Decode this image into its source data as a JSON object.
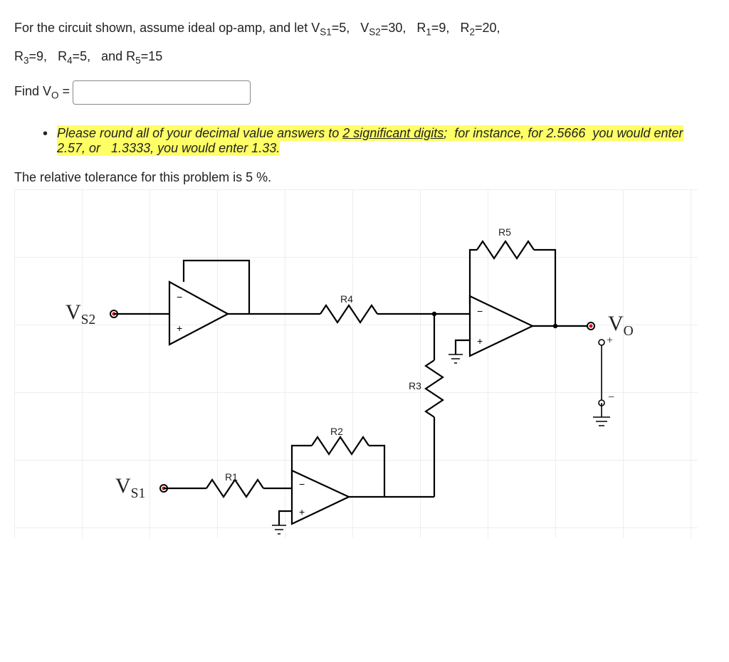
{
  "problem": {
    "line1_prefix": "For the circuit shown, assume ideal op-amp, and let V",
    "vs1_sub": "S1",
    "vs1_val": "=5,",
    "gap1": "   V",
    "vs2_sub": "S2",
    "vs2_val": "=30,",
    "r1": "   R",
    "r1_sub": "1",
    "r1_val": "=9,",
    "r2": "   R",
    "r2_sub": "2",
    "r2_val": "=20,",
    "line2_r3": "R",
    "r3_sub": "3",
    "r3_val": "=9,",
    "r4": "   R",
    "r4_sub": "4",
    "r4_val": "=5,",
    "and": "   and R",
    "r5_sub": "5",
    "r5_val": "=15"
  },
  "find": {
    "prefix": "Find V",
    "sub": "O",
    "eq": " = "
  },
  "note": {
    "t1": "Please round all of your decimal value answers to ",
    "t2": "2 significant digits",
    "t3": ";  for instance, for 2.5666  you would enter 2.57, or   1.3333, you would enter 1.33."
  },
  "tolerance": "The relative tolerance for this problem is 5 %.",
  "circuit": {
    "R1": "R1",
    "R2": "R2",
    "R3": "R3",
    "R4": "R4",
    "R5": "R5",
    "VS1": "V",
    "VS1_sub": "S1",
    "VS2": "V",
    "VS2_sub": "S2",
    "VO": "V",
    "VO_sub": "O",
    "plus": "+",
    "minus": "−"
  }
}
